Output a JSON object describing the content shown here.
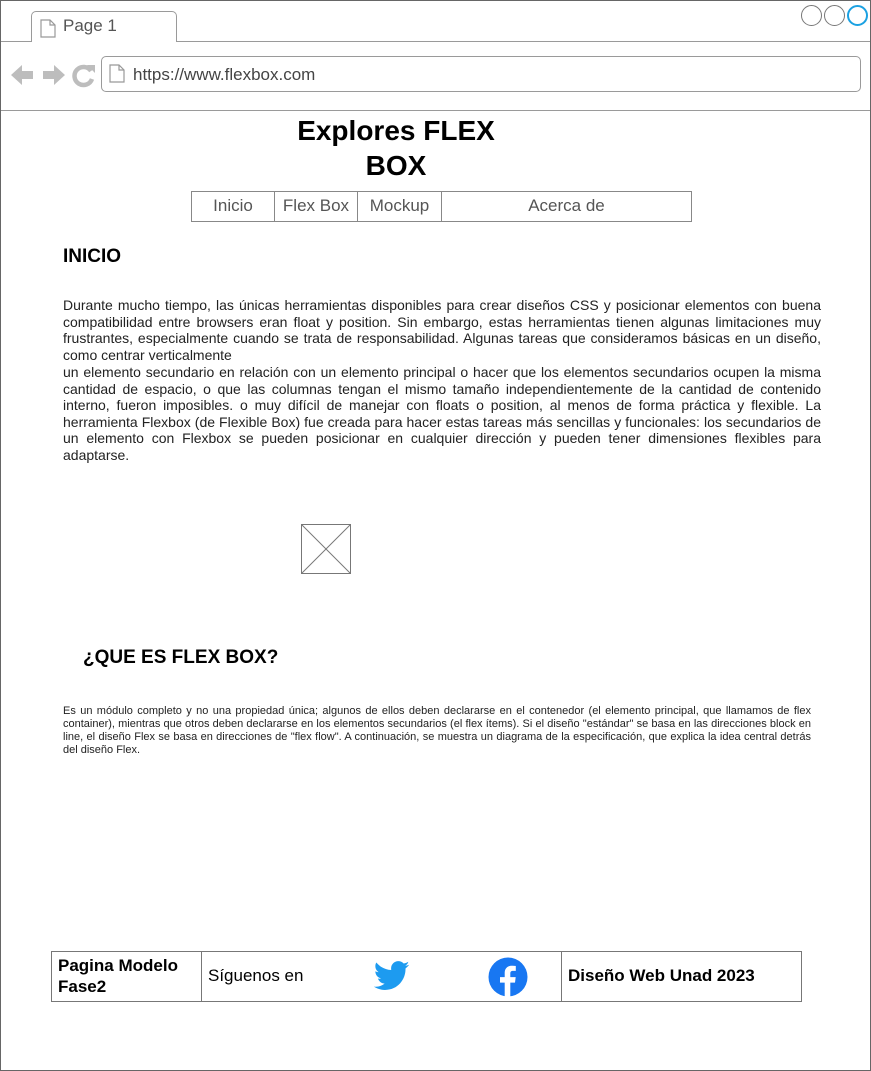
{
  "browser": {
    "tab_label": "Page 1",
    "url": "https://www.flexbox.com"
  },
  "header": {
    "title_line1": "Explores FLEX",
    "title_line2": "BOX"
  },
  "menu": {
    "items": [
      {
        "label": "Inicio"
      },
      {
        "label": "Flex Box"
      },
      {
        "label": "Mockup"
      },
      {
        "label": "Acerca de"
      }
    ]
  },
  "inicio": {
    "heading": "INICIO",
    "paragraph1": "Durante mucho tiempo, las únicas herramientas disponibles para crear diseños CSS y posicionar elementos con buena compatibilidad entre browsers eran float y position. Sin embargo, estas herramientas tienen algunas limitaciones muy frustrantes, especialmente cuando se trata de responsabilidad. Algunas tareas que consideramos básicas en un diseño, como centrar verticalmente",
    "paragraph2": "un elemento secundario en relación con un elemento principal o hacer que los elementos secundarios ocupen la misma cantidad de espacio, o que las columnas tengan el mismo tamaño independientemente de la cantidad de contenido interno, fueron imposibles. o muy difícil de manejar con floats o position, al menos de forma práctica y flexible. La herramienta Flexbox (de Flexible Box) fue creada para hacer estas tareas más sencillas y funcionales: los secundarios de un elemento con Flexbox se pueden posicionar en cualquier dirección y pueden tener dimensiones flexibles para adaptarse."
  },
  "que_es": {
    "heading": "¿QUE ES FLEX BOX?",
    "paragraph": "Es un módulo completo y no una propiedad única; algunos de ellos deben declararse en el contenedor (el elemento principal, que llamamos de flex container), mientras que otros deben declararse en los elementos secundarios (el flex ítems). Si el diseño \"estándar\" se basa en las direcciones block en line, el diseño Flex se basa en direcciones de \"flex flow\". A continuación, se muestra un diagrama de la especificación, que explica la idea central detrás del diseño Flex."
  },
  "footer": {
    "page_model_line1": "Pagina Modelo",
    "page_model_line2": "Fase2",
    "follow_text": "Síguenos en",
    "twitter_icon": "twitter-icon",
    "facebook_icon": "facebook-icon",
    "credit": "Diseño Web Unad 2023"
  },
  "colors": {
    "twitter": "#1d9bf0",
    "facebook": "#1877f2",
    "window_active": "#1ba1e2"
  }
}
